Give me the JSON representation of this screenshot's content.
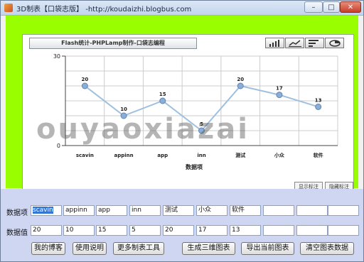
{
  "window": {
    "title": "3D制表【口袋志版】 -http://koudaizhi.blogbus.com",
    "minimize_label": "–",
    "maximize_label": "□",
    "close_label": "✕"
  },
  "chart_toolbar": {
    "icons": [
      "bar-chart-icon",
      "line-chart-icon",
      "horizontal-bar-icon",
      "pie-chart-icon"
    ],
    "show_labels_button": "显示标注",
    "hide_labels_button": "隐藏标注"
  },
  "watermark": "ouyaoxiazai",
  "chart_data": {
    "type": "line",
    "title": "Flash统计-PHPLamp制作-口袋志编程",
    "xlabel": "数据项",
    "ylabel": "",
    "categories": [
      "scavin",
      "appinn",
      "app",
      "inn",
      "测试",
      "小众",
      "软件"
    ],
    "values": [
      20,
      10,
      15,
      5,
      20,
      17,
      13
    ],
    "ylim": [
      0,
      30
    ],
    "yticks": [
      0,
      30
    ],
    "grid": true,
    "line_color": "#9ec0de",
    "marker_color": "#8aaed6",
    "legend": "none"
  },
  "form": {
    "item_row_label": "数据项",
    "value_row_label": "数据值",
    "items": [
      "scavin",
      "appinn",
      "app",
      "inn",
      "测试",
      "小众",
      "软件",
      "",
      "",
      ""
    ],
    "values": [
      "20",
      "10",
      "15",
      "5",
      "20",
      "17",
      "13",
      "",
      "",
      ""
    ]
  },
  "buttons": {
    "my_blog": "我的博客",
    "instructions": "使用说明",
    "more_tools": "更多制表工具",
    "generate_3d": "生成三维图表",
    "export_chart": "导出当前图表",
    "clear_data": "清空图表数据"
  },
  "colors": {
    "flash_bg": "#99ff00",
    "form_bg": "#cfd6f2",
    "grid": "#cccccc"
  }
}
